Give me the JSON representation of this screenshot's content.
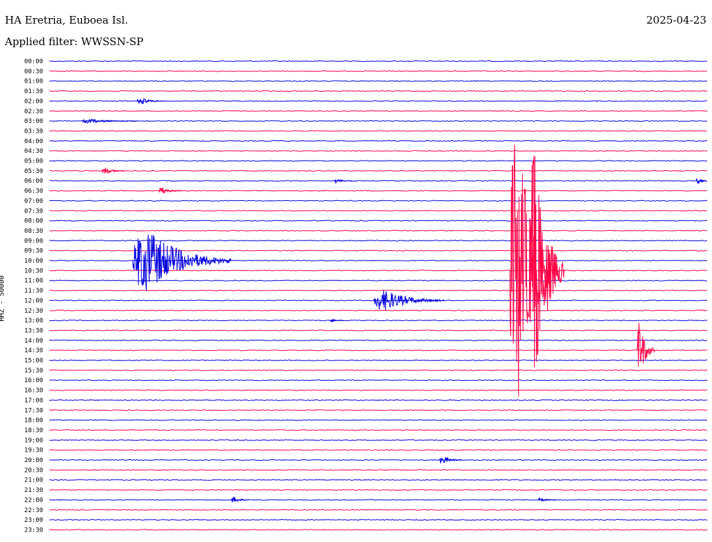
{
  "header": {
    "station": "HA Eretria, Euboea Isl.",
    "date": "2025-04-23",
    "filter": "Applied filter: WWSSN-SP"
  },
  "chart_data": {
    "type": "line",
    "title": "HA Eretria, Euboea Isl.",
    "ylabel": "HHZ - 50000",
    "row_labels": [
      "00:00",
      "00:30",
      "01:00",
      "01:30",
      "02:00",
      "02:30",
      "03:00",
      "03:30",
      "04:00",
      "04:30",
      "05:00",
      "05:30",
      "06:00",
      "06:30",
      "07:00",
      "07:30",
      "08:00",
      "08:30",
      "09:00",
      "09:30",
      "10:00",
      "10:30",
      "11:00",
      "11:30",
      "12:00",
      "12:30",
      "13:00",
      "13:30",
      "14:00",
      "14:30",
      "15:00",
      "15:30",
      "16:00",
      "16:30",
      "17:00",
      "17:30",
      "18:00",
      "18:30",
      "19:00",
      "19:30",
      "20:00",
      "20:30",
      "21:00",
      "21:30",
      "22:00",
      "22:30",
      "23:00",
      "23:30"
    ],
    "row_minutes": 30,
    "series_colors": [
      "#0000dd",
      "#ff0044"
    ],
    "grid": false,
    "events": [
      {
        "row": 4,
        "minute": 4.0,
        "amp": 8,
        "dur": 1.2
      },
      {
        "row": 6,
        "minute": 1.5,
        "amp": 5,
        "dur": 2.5
      },
      {
        "row": 11,
        "minute": 2.4,
        "amp": 8,
        "dur": 1.0
      },
      {
        "row": 12,
        "minute": 13.0,
        "amp": 6,
        "dur": 0.8
      },
      {
        "row": 12,
        "minute": 29.5,
        "amp": 8,
        "dur": 0.6
      },
      {
        "row": 13,
        "minute": 5.0,
        "amp": 9,
        "dur": 1.0
      },
      {
        "row": 20,
        "minute": 3.8,
        "amp": 75,
        "dur": 4.5
      },
      {
        "row": 24,
        "minute": 14.8,
        "amp": 25,
        "dur": 3.2
      },
      {
        "row": 26,
        "minute": 12.8,
        "amp": 4,
        "dur": 0.6
      },
      {
        "row": 21,
        "minute": 21.0,
        "amp": 330,
        "dur": 2.2
      },
      {
        "row": 21,
        "minute": 21.9,
        "amp": 300,
        "dur": 1.6
      },
      {
        "row": 29,
        "minute": 26.8,
        "amp": 70,
        "dur": 0.8
      },
      {
        "row": 40,
        "minute": 17.8,
        "amp": 10,
        "dur": 1.0
      },
      {
        "row": 44,
        "minute": 8.3,
        "amp": 8,
        "dur": 0.8
      },
      {
        "row": 44,
        "minute": 22.3,
        "amp": 5,
        "dur": 0.8
      }
    ]
  }
}
